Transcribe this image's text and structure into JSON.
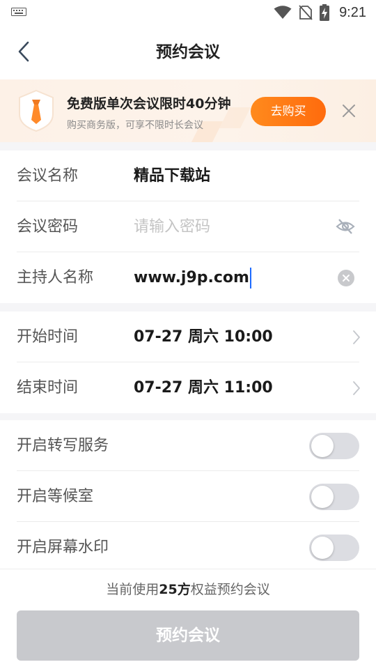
{
  "status_bar": {
    "time": "9:21",
    "icons": [
      "keyboard-icon",
      "wifi-icon",
      "no-sim-icon",
      "battery-charging-icon"
    ]
  },
  "nav": {
    "title": "预约会议",
    "back_icon": "chevron-left-icon"
  },
  "promo": {
    "headline": "免费版单次会议限时40分钟",
    "sub": "购买商务版，可享不限时长会议",
    "buy_label": "去购买",
    "accent": "#ff7a12",
    "close_icon": "close-icon"
  },
  "meeting": {
    "name_label": "会议名称",
    "name_value": "精品下载站",
    "password_label": "会议密码",
    "password_placeholder": "请输入密码",
    "host_label": "主持人名称",
    "host_value": "www.j9p.com"
  },
  "schedule": {
    "start_label": "开始时间",
    "start_value": "07-27 周六 10:00",
    "end_label": "结束时间",
    "end_value": "07-27 周六 11:00"
  },
  "options": [
    {
      "label": "开启转写服务",
      "on": false
    },
    {
      "label": "开启等候室",
      "on": false
    },
    {
      "label": "开启屏幕水印",
      "on": false
    }
  ],
  "footer": {
    "note_prefix": "当前使用",
    "note_bold": "25方",
    "note_suffix": "权益预约会议",
    "submit_label": "预约会议",
    "submit_color": "#c8c9cd"
  }
}
